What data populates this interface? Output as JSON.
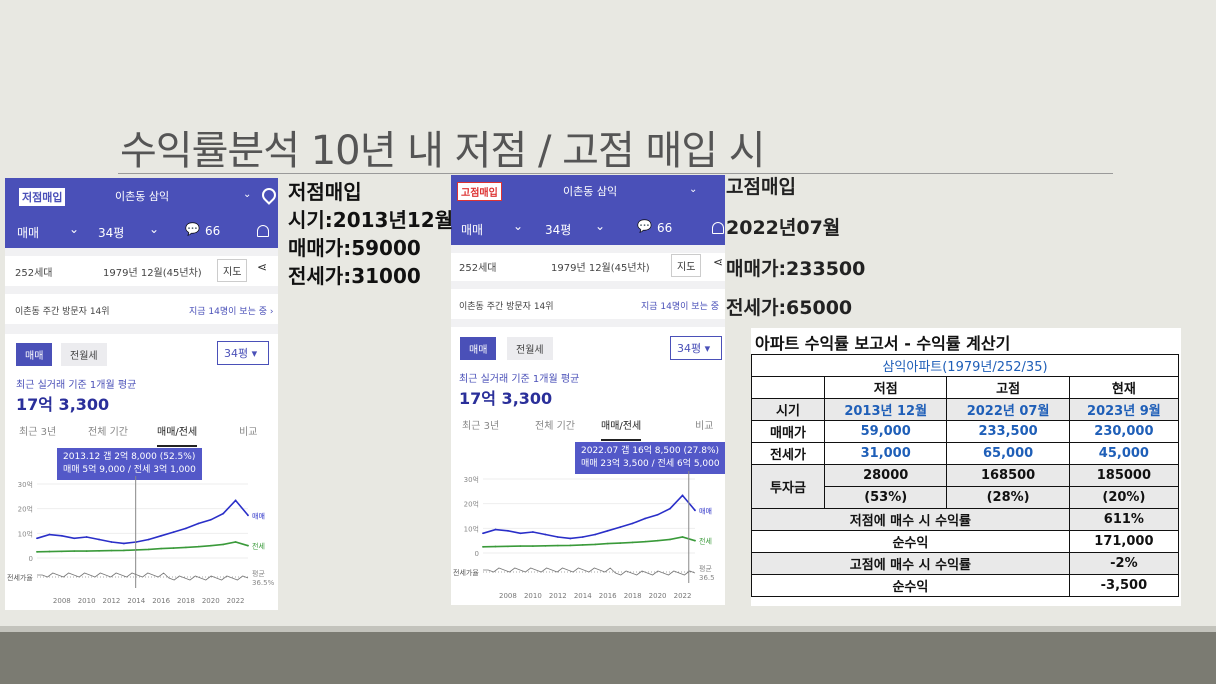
{
  "slide": {
    "title": "수익률분석 10년 내 저점 / 고점 매입 시"
  },
  "phones": [
    {
      "badge": "저점매입",
      "complex": "이촌동 삼익",
      "filters": {
        "deal": "매매",
        "size": "34평",
        "comments": "66"
      },
      "info": {
        "households": "252세대",
        "built": "1979년 12월(45년차)",
        "map_button": "지도"
      },
      "visitor": {
        "rank": "이촌동 주간 방문자 14위",
        "live": "지금 14명이 보는 중 ›"
      },
      "toggle": {
        "selected": "매매",
        "other": "전월세",
        "size": "34평"
      },
      "avg_label": "최근 실거래 기준 1개월 평균",
      "avg_price": "17억 3,300",
      "period_tabs": [
        "최근 3년",
        "전체 기간",
        "매매/전세",
        "비교"
      ],
      "tooltip": {
        "line1": "2013.12  갭 2억 8,000 (52.5%)",
        "line2": "매매 5억 9,000 / 전세 3억 1,000"
      },
      "side_labels": {
        "sale": "매매",
        "lease": "전세",
        "avg": "평균",
        "avg_pct": "36.5%",
        "ratio_label": "전세가율"
      }
    },
    {
      "badge": "고점매입",
      "complex": "이촌동 삼익",
      "filters": {
        "deal": "매매",
        "size": "34평",
        "comments": "66"
      },
      "info": {
        "households": "252세대",
        "built": "1979년 12월(45년차)",
        "map_button": "지도"
      },
      "visitor": {
        "rank": "이촌동 주간 방문자 14위",
        "live": "지금 14명이 보는 중"
      },
      "toggle": {
        "selected": "매매",
        "other": "전월세",
        "size": "34평"
      },
      "avg_label": "최근 실거래 기준 1개월 평균",
      "avg_price": "17억 3,300",
      "period_tabs": [
        "최근 3년",
        "전체 기간",
        "매매/전세",
        "비교"
      ],
      "tooltip": {
        "line1": "2022.07  갭 16억 8,500 (27.8%)",
        "line2": "매매 23억 3,500 / 전세 6억 5,000"
      },
      "side_labels": {
        "sale": "매매",
        "lease": "전세",
        "avg": "평균",
        "avg_pct": "36.5",
        "ratio_label": "전세가율"
      }
    }
  ],
  "chart_data": [
    {
      "type": "line",
      "x": [
        2006,
        2007,
        2008,
        2009,
        2010,
        2011,
        2012,
        2013,
        2014,
        2015,
        2016,
        2017,
        2018,
        2019,
        2020,
        2021,
        2022,
        2023
      ],
      "xticks": [
        "2008",
        "2010",
        "2012",
        "2014",
        "2016",
        "2018",
        "2020",
        "2022"
      ],
      "yticks": [
        "30억",
        "20억",
        "10억",
        "0"
      ],
      "ylim": [
        0,
        30
      ],
      "series": [
        {
          "name": "매매",
          "values": [
            8,
            9.5,
            9,
            8,
            8.5,
            7.5,
            6.5,
            5.9,
            6.5,
            7.5,
            9,
            10.5,
            12,
            14,
            15.5,
            18,
            23.35,
            17.3
          ]
        },
        {
          "name": "전세",
          "values": [
            2.5,
            2.6,
            2.7,
            2.8,
            2.8,
            2.9,
            3.0,
            3.1,
            3.3,
            3.5,
            3.8,
            4.0,
            4.3,
            4.6,
            5.0,
            5.5,
            6.5,
            5.0
          ]
        }
      ]
    },
    {
      "type": "line",
      "x": [
        2006,
        2007,
        2008,
        2009,
        2010,
        2011,
        2012,
        2013,
        2014,
        2015,
        2016,
        2017,
        2018,
        2019,
        2020,
        2021,
        2022,
        2023
      ],
      "xticks": [
        "2008",
        "2010",
        "2012",
        "2014",
        "2016",
        "2018",
        "2020",
        "2022"
      ],
      "yticks": [
        "30억",
        "20억",
        "10억",
        "0"
      ],
      "ylim": [
        0,
        30
      ],
      "series": [
        {
          "name": "매매",
          "values": [
            8,
            9.5,
            9,
            8,
            8.5,
            7.5,
            6.5,
            5.9,
            6.5,
            7.5,
            9,
            10.5,
            12,
            14,
            15.5,
            18,
            23.35,
            17.3
          ]
        },
        {
          "name": "전세",
          "values": [
            2.5,
            2.6,
            2.7,
            2.8,
            2.8,
            2.9,
            3.0,
            3.1,
            3.3,
            3.5,
            3.8,
            4.0,
            4.3,
            4.6,
            5.0,
            5.5,
            6.5,
            5.0
          ]
        }
      ]
    }
  ],
  "annotations": {
    "low": {
      "title": "저점매입",
      "time": "시기:2013년12월",
      "sale": "매매가:59000",
      "lease": "전세가:31000"
    },
    "high": {
      "title": "고점매입",
      "time": "2022년07월",
      "sale": "매매가:233500",
      "lease": "전세가:65000"
    }
  },
  "report": {
    "title": "아파트 수익률 보고서 - 수익률 계산기",
    "subtitle": "삼익아파트(1979년/252/35)",
    "headers": [
      "저점",
      "고점",
      "현재"
    ],
    "rows": [
      {
        "label": "시기",
        "values": [
          "2013년 12월",
          "2022년 07월",
          "2023년 9월"
        ]
      },
      {
        "label": "매매가",
        "values": [
          "59,000",
          "233,500",
          "230,000"
        ]
      },
      {
        "label": "전세가",
        "values": [
          "31,000",
          "65,000",
          "45,000"
        ]
      }
    ],
    "investment": {
      "label": "투자금",
      "values": [
        "28000",
        "168500",
        "185000"
      ],
      "pcts": [
        "(53%)",
        "(28%)",
        "(20%)"
      ]
    },
    "summary": [
      {
        "label": "저점에 매수 시 수익률",
        "value": "611%"
      },
      {
        "label": "순수익",
        "value": "171,000"
      },
      {
        "label": "고점에 매수 시 수익률",
        "value": "-2%"
      },
      {
        "label": "순수익",
        "value": "-3,500"
      }
    ]
  }
}
